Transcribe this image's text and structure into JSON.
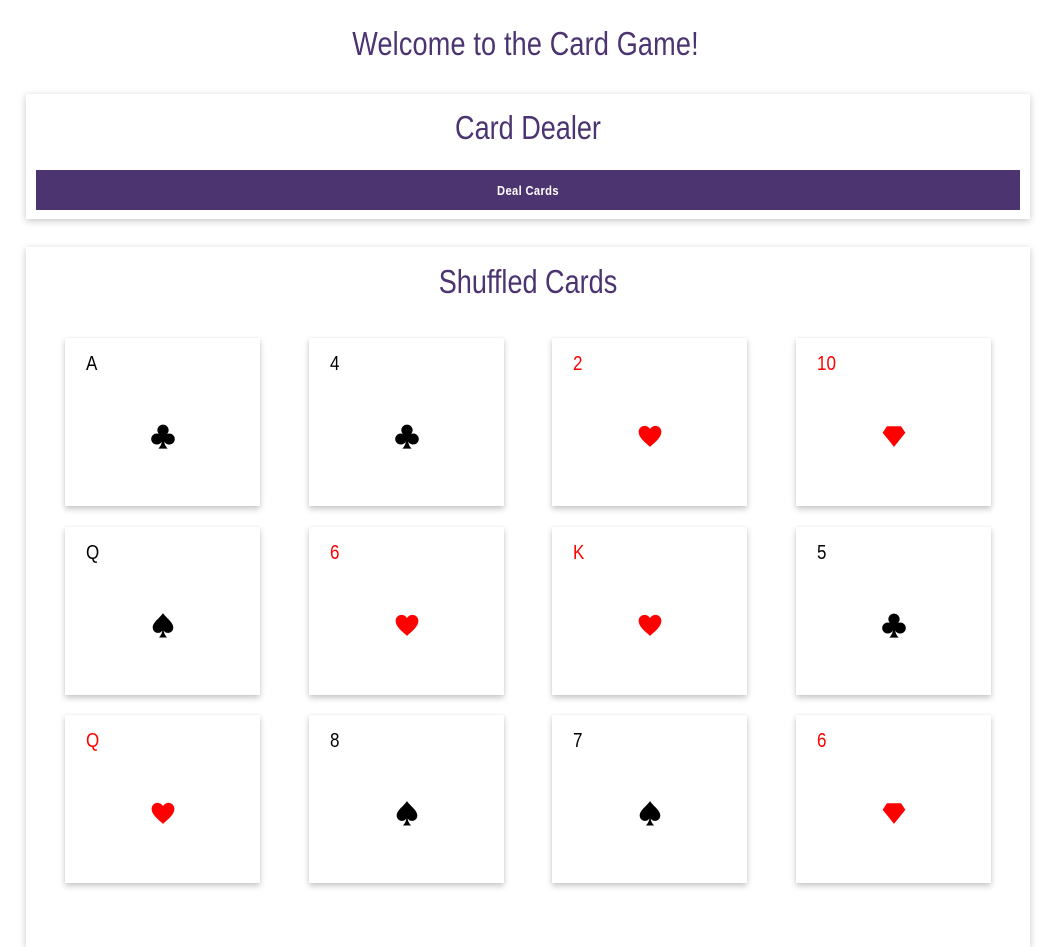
{
  "page": {
    "title": "Welcome to the Card Game!"
  },
  "dealer": {
    "title": "Card Dealer",
    "deal_button_label": "Deal Cards"
  },
  "shuffled": {
    "title": "Shuffled Cards",
    "cards": [
      {
        "rank": "A",
        "suit": "club",
        "color": "black"
      },
      {
        "rank": "4",
        "suit": "club",
        "color": "black"
      },
      {
        "rank": "2",
        "suit": "heart",
        "color": "red"
      },
      {
        "rank": "10",
        "suit": "diamond",
        "color": "red"
      },
      {
        "rank": "Q",
        "suit": "spade",
        "color": "black"
      },
      {
        "rank": "6",
        "suit": "heart",
        "color": "red"
      },
      {
        "rank": "K",
        "suit": "heart",
        "color": "red"
      },
      {
        "rank": "5",
        "suit": "club",
        "color": "black"
      },
      {
        "rank": "Q",
        "suit": "heart",
        "color": "red"
      },
      {
        "rank": "8",
        "suit": "spade",
        "color": "black"
      },
      {
        "rank": "7",
        "suit": "spade",
        "color": "black"
      },
      {
        "rank": "6",
        "suit": "diamond",
        "color": "red"
      }
    ]
  },
  "colors": {
    "accent": "#4c3470",
    "red_suit": "#ff0000",
    "black_suit": "#000000"
  }
}
